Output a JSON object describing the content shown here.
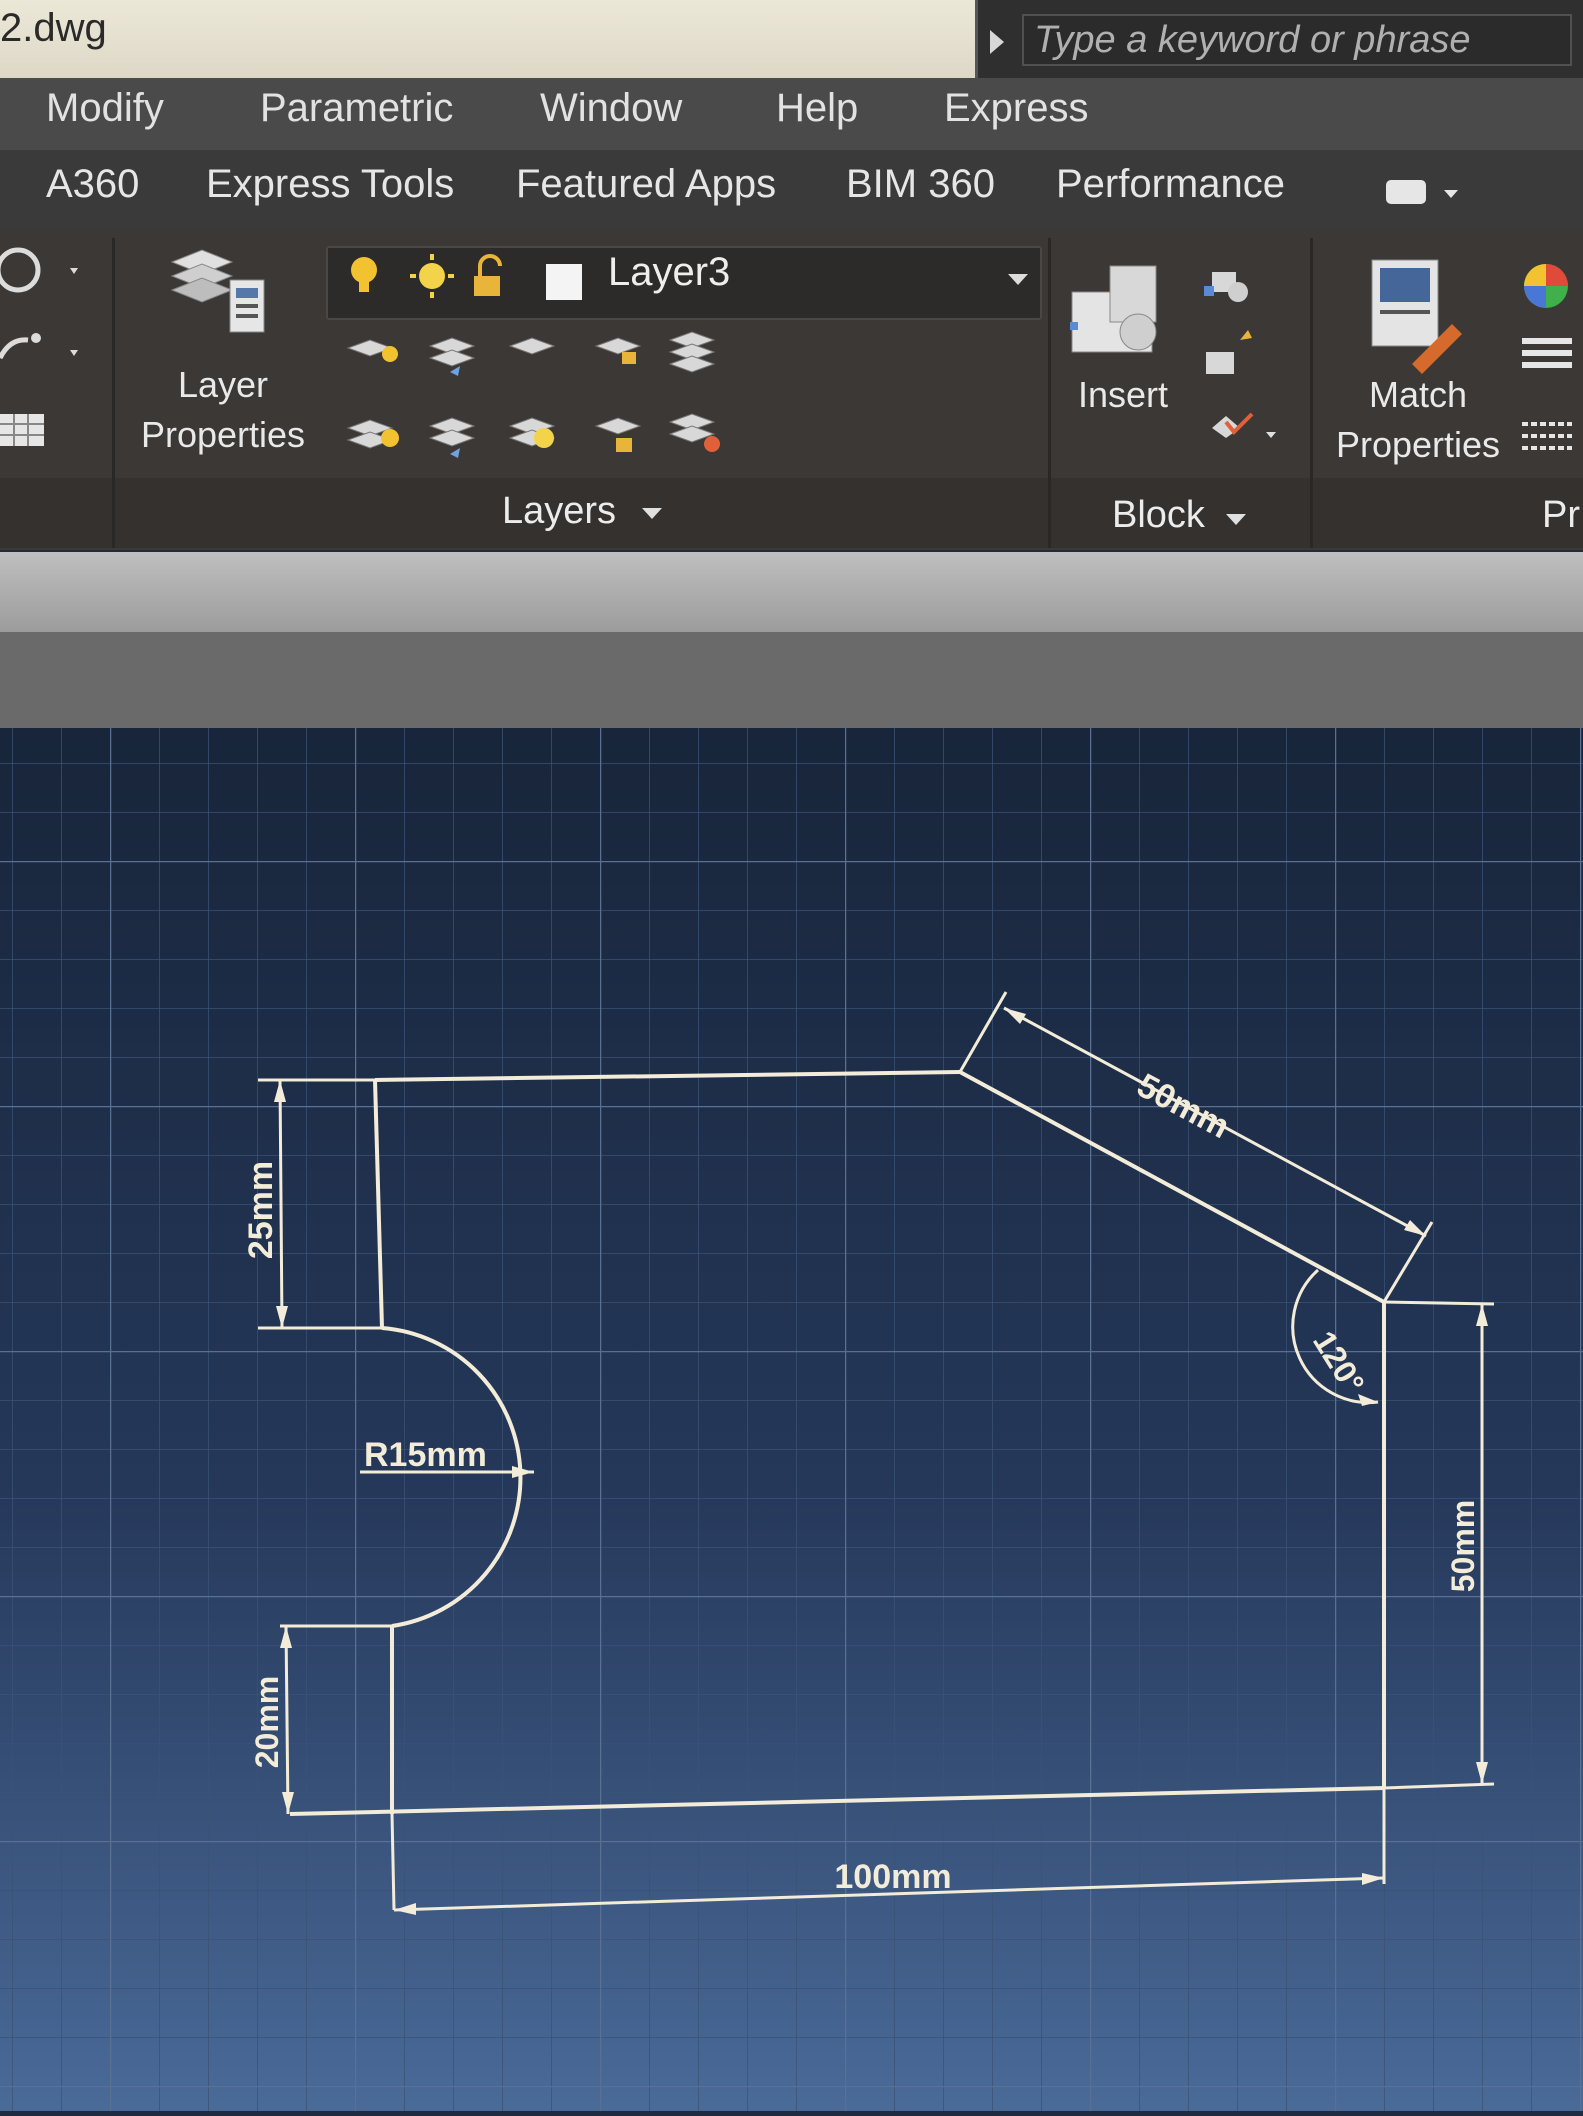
{
  "window": {
    "title": "2.dwg"
  },
  "search": {
    "placeholder": "Type a keyword or phrase"
  },
  "menu": {
    "items": [
      "Modify",
      "Parametric",
      "Window",
      "Help",
      "Express"
    ]
  },
  "ribbon_tabs": {
    "items": [
      "A360",
      "Express Tools",
      "Featured Apps",
      "BIM 360",
      "Performance"
    ]
  },
  "ribbon": {
    "layers_panel": {
      "title": "Layers",
      "layer_properties_label": "Layer Properties",
      "current_layer": "Layer3"
    },
    "block_panel": {
      "title": "Block",
      "insert_label": "Insert"
    },
    "properties_panel": {
      "title": "Pr",
      "match_properties_label": "Match Properties"
    }
  },
  "drawing": {
    "dimensions": {
      "slant": "50mm",
      "left_top": "25mm",
      "radius": "R15mm",
      "left_bottom": "20mm",
      "angle": "120°",
      "right": "50mm",
      "bottom": "100mm"
    }
  },
  "colors": {
    "canvas_top": "#18253a",
    "canvas_bottom": "#4a6a98",
    "line": "#f2ecd8",
    "ribbon": "#3b3835"
  }
}
